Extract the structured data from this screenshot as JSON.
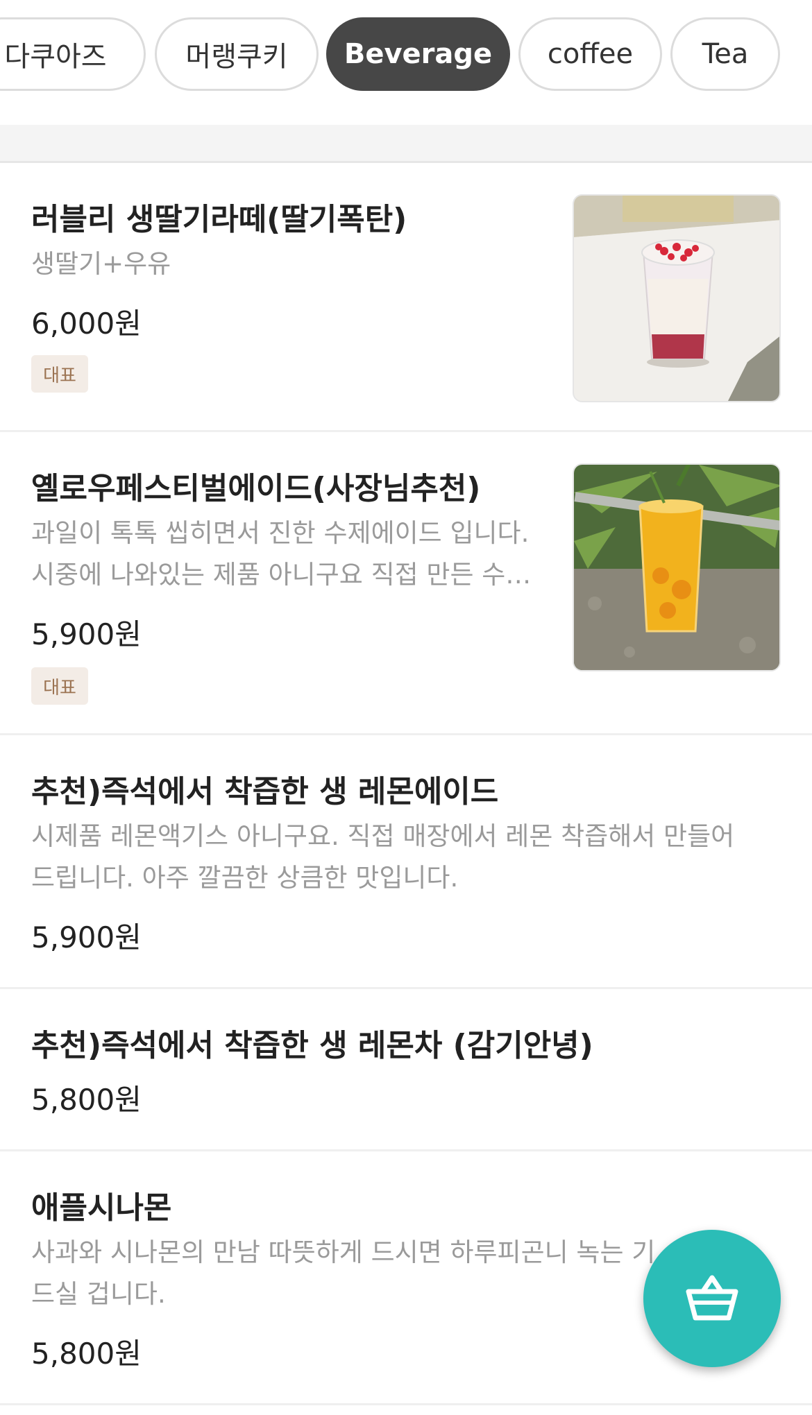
{
  "tabs": [
    "다쿠아즈",
    "머랭쿠키",
    "Beverage",
    "coffee",
    "Tea"
  ],
  "active_tab": "Beverage",
  "items": [
    {
      "name": "러블리 생딸기라떼(딸기폭탄)",
      "desc1": "생딸기+우유",
      "price": "6,000원",
      "badge": "대표",
      "image": "strawberry-latte-photo"
    },
    {
      "name": "옐로우페스티벌에이드(사장님추천)",
      "desc1": "과일이 톡톡 씹히면서 진한 수제에이드 입니다.",
      "desc2": "시중에 나와있는 제품 아니구요 직접 만든 수…",
      "price": "5,900원",
      "badge": "대표",
      "image": "yellow-ade-photo"
    },
    {
      "name": "추천)즉석에서 착즙한 생 레몬에이드",
      "desc1": "시제품 레몬액기스 아니구요. 직접 매장에서 레몬 착즙해서 만들어",
      "desc2": "드립니다. 아주 깔끔한 상큼한 맛입니다.",
      "price": "5,900원"
    },
    {
      "name": "추천)즉석에서 착즙한 생 레몬차 (감기안녕)",
      "price": "5,800원"
    },
    {
      "name": "애플시나몬",
      "desc1": "사과와 시나몬의 만남 따뜻하게 드시면 하루피곤니 녹는 기",
      "desc2": "드실 겁니다.",
      "price": "5,800원"
    }
  ],
  "cart_icon": "basket-icon",
  "colors": {
    "active_tab": "#474747",
    "fab": "#2bbdb7",
    "badge_bg": "#f3ece6",
    "badge_text": "#9b7352"
  }
}
